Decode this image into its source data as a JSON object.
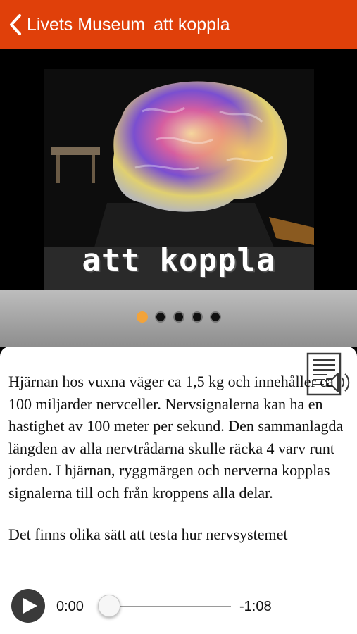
{
  "header": {
    "back_label": "Livets Museum",
    "title": "att koppla",
    "accent_color": "#e0400a"
  },
  "gallery": {
    "image_caption": "att koppla",
    "image_subject": "glowing-brain-sculpture",
    "page_count": 5,
    "current_page": 1
  },
  "article": {
    "icon": "document-audio-icon",
    "paragraphs": [
      "Hjärnan hos vuxna väger ca 1,5 kg och innehåller ca 100 miljarder nervceller. Nervsignalerna kan ha en hastighet av 100 meter per sekund. Den sammanlagda längden av alla nervtrådarna skulle räcka 4 varv runt jorden. I hjärnan, ryggmärgen och nerverna kopplas signalerna till och från kroppens alla delar.",
      "Det finns olika sätt att testa hur nervsystemet"
    ]
  },
  "player": {
    "elapsed": "0:00",
    "remaining": "-1:08",
    "progress": 0
  }
}
